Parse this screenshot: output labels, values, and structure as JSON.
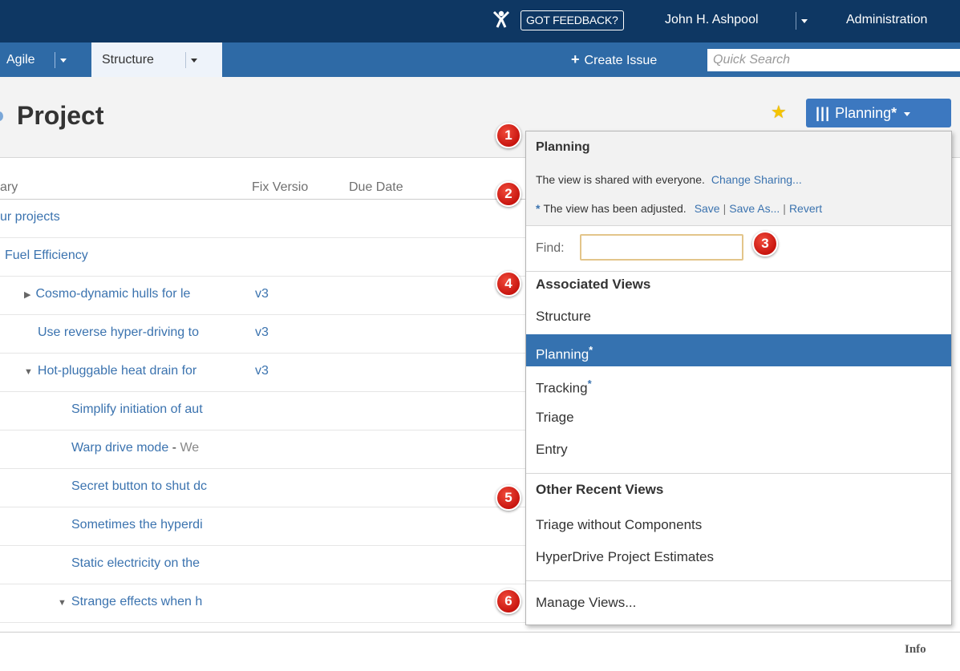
{
  "header": {
    "feedback_label": "GOT FEEDBACK?",
    "user_name": "John H. Ashpool",
    "admin_label": "Administration"
  },
  "nav": {
    "agile_label": "Agile",
    "structure_label": "Structure",
    "create_issue_label": "Create Issue",
    "quick_search_placeholder": "Quick Search"
  },
  "page": {
    "title": "Project",
    "view_button_label": "Planning",
    "view_button_asterisk": "*"
  },
  "table": {
    "headers": {
      "summary": "ary",
      "fix_version": "Fix Versio",
      "due_date": "Due Date"
    },
    "rows": [
      {
        "summary": "ur projects",
        "version": ""
      },
      {
        "summary": "Fuel Efficiency",
        "version": ""
      },
      {
        "summary": "Cosmo-dynamic hulls for le",
        "version": "v3"
      },
      {
        "summary": "Use reverse hyper-driving to",
        "version": "v3"
      },
      {
        "summary": "Hot-pluggable heat drain for",
        "version": "v3"
      },
      {
        "summary": "Simplify initiation of aut",
        "version": ""
      },
      {
        "summary": "Warp drive mode",
        "dash": " - ",
        "extra": "We",
        "version": ""
      },
      {
        "summary": "Secret button to shut dc",
        "version": ""
      },
      {
        "summary": "Sometimes the hyperdi",
        "version": ""
      },
      {
        "summary": "Static electricity on the",
        "version": ""
      },
      {
        "summary": "Strange effects when h",
        "version": ""
      }
    ],
    "info_label": "Info"
  },
  "dropdown": {
    "title": "Planning",
    "shared_text": "The view is shared with everyone.",
    "change_sharing_label": "Change Sharing...",
    "adjusted_asterisk": "*",
    "adjusted_text": "The view has been adjusted.",
    "save_label": "Save",
    "save_as_label": "Save As...",
    "revert_label": "Revert",
    "separator": "|",
    "find_label": "Find:",
    "associated_heading": "Associated Views",
    "associated_items": [
      {
        "label": "Structure",
        "asterisk": ""
      },
      {
        "label": "Planning",
        "asterisk": "*"
      },
      {
        "label": "Tracking",
        "asterisk": "*"
      },
      {
        "label": "Triage",
        "asterisk": ""
      },
      {
        "label": "Entry",
        "asterisk": ""
      }
    ],
    "recent_heading": "Other Recent Views",
    "recent_items": [
      "Triage without Components",
      "HyperDrive Project Estimates"
    ],
    "manage_label": "Manage Views..."
  },
  "callouts": [
    "1",
    "2",
    "3",
    "4",
    "5",
    "6"
  ],
  "colors": {
    "header_bg": "#0e3763",
    "nav_bg": "#2e6aa6",
    "accent": "#3572b0",
    "callout_red": "#d9261c"
  },
  "icons": {
    "feedback": "feedback-person-icon",
    "star": "favourite-star-icon",
    "bars": "view-bars-icon",
    "caret": "caret-down-icon",
    "plus": "plus-icon"
  }
}
